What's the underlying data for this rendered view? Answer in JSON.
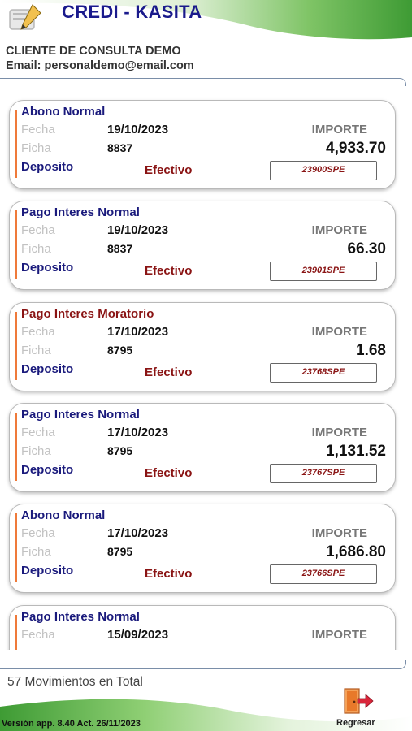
{
  "header": {
    "title": "CREDI - KASITA"
  },
  "client": {
    "name": "CLIENTE DE CONSULTA DEMO",
    "email": "Email: personaldemo@email.com"
  },
  "labels": {
    "fecha": "Fecha",
    "ficha": "Ficha",
    "importe": "IMPORTE"
  },
  "movements": [
    {
      "type": "Abono Normal",
      "type_color": "blue",
      "fecha": "19/10/2023",
      "ficha": "8837",
      "importe": "4,933.70",
      "deposit": "Deposito",
      "method": "Efectivo",
      "ref": "23900SPE"
    },
    {
      "type": "Pago Interes Normal",
      "type_color": "blue",
      "fecha": "19/10/2023",
      "ficha": "8837",
      "importe": "66.30",
      "deposit": "Deposito",
      "method": "Efectivo",
      "ref": "23901SPE"
    },
    {
      "type": "Pago Interes Moratorio",
      "type_color": "red",
      "fecha": "17/10/2023",
      "ficha": "8795",
      "importe": "1.68",
      "deposit": "Deposito",
      "method": "Efectivo",
      "ref": "23768SPE"
    },
    {
      "type": "Pago Interes Normal",
      "type_color": "blue",
      "fecha": "17/10/2023",
      "ficha": "8795",
      "importe": "1,131.52",
      "deposit": "Deposito",
      "method": "Efectivo",
      "ref": "23767SPE"
    },
    {
      "type": "Abono Normal",
      "type_color": "blue",
      "fecha": "17/10/2023",
      "ficha": "8795",
      "importe": "1,686.80",
      "deposit": "Deposito",
      "method": "Efectivo",
      "ref": "23766SPE"
    },
    {
      "type": "Pago Interes Normal",
      "type_color": "blue",
      "fecha": "15/09/2023",
      "ficha": "",
      "importe": "",
      "deposit": "",
      "method": "",
      "ref": ""
    }
  ],
  "footer": {
    "total": "57 Movimientos en Total",
    "version": "Versión app. 8.40 Act. 26/11/2023",
    "back_label": "Regresar"
  },
  "colors": {
    "brand_green": "#4caf50",
    "navy": "#1a1a7c",
    "dark_red": "#8a1414",
    "accent_orange": "#ef7a3a"
  }
}
